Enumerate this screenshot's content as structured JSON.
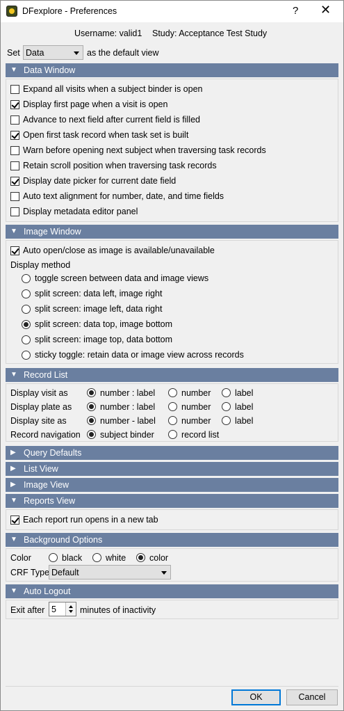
{
  "window": {
    "title": "DFexplore - Preferences",
    "help_glyph": "?",
    "close_glyph": "✕"
  },
  "header": {
    "username": "Username: valid1",
    "study": "Study: Acceptance Test Study"
  },
  "default_view": {
    "prefix": "Set",
    "value": "Data",
    "suffix": "as the default view"
  },
  "sections": {
    "data_window": "Data Window",
    "image_window": "Image Window",
    "record_list": "Record List",
    "query_defaults": "Query Defaults",
    "list_view": "List View",
    "image_view": "Image View",
    "reports_view": "Reports View",
    "background_options": "Background Options",
    "auto_logout": "Auto Logout"
  },
  "data_window": {
    "options": [
      {
        "label": "Expand all visits when a subject binder is open",
        "checked": false
      },
      {
        "label": "Display first page when a visit is open",
        "checked": true
      },
      {
        "label": "Advance to next field after current field is filled",
        "checked": false
      },
      {
        "label": "Open first task record when task set is built",
        "checked": true
      },
      {
        "label": "Warn before opening next subject when traversing task records",
        "checked": false
      },
      {
        "label": "Retain scroll position when traversing task records",
        "checked": false
      },
      {
        "label": "Display date picker for current date field",
        "checked": true
      },
      {
        "label": "Auto text alignment for number, date, and time fields",
        "checked": false
      },
      {
        "label": "Display metadata editor panel",
        "checked": false
      }
    ]
  },
  "image_window": {
    "auto_open": {
      "label": "Auto open/close as image is available/unavailable",
      "checked": true
    },
    "display_method_label": "Display method",
    "methods": [
      {
        "label": "toggle screen between data and image views",
        "selected": false
      },
      {
        "label": "split screen: data left, image right",
        "selected": false
      },
      {
        "label": "split screen: image left, data right",
        "selected": false
      },
      {
        "label": "split screen: data top, image bottom",
        "selected": true
      },
      {
        "label": "split screen: image top, data bottom",
        "selected": false
      },
      {
        "label": "sticky toggle: retain data or image view across records",
        "selected": false
      }
    ]
  },
  "record_list": {
    "rows": [
      {
        "label": "Display visit as",
        "opts": [
          "number : label",
          "number",
          "label"
        ],
        "selected": 0
      },
      {
        "label": "Display plate as",
        "opts": [
          "number : label",
          "number",
          "label"
        ],
        "selected": 0
      },
      {
        "label": "Display site as",
        "opts": [
          "number - label",
          "number",
          "label"
        ],
        "selected": 0
      },
      {
        "label": "Record navigation",
        "opts": [
          "subject binder",
          "record list"
        ],
        "selected": 0
      }
    ]
  },
  "reports_view": {
    "new_tab": {
      "label": "Each report run opens in a new tab",
      "checked": true
    }
  },
  "background_options": {
    "color_label": "Color",
    "colors": [
      {
        "label": "black",
        "selected": false
      },
      {
        "label": "white",
        "selected": false
      },
      {
        "label": "color",
        "selected": true
      }
    ],
    "crf_type_label": "CRF Type",
    "crf_type_value": "Default"
  },
  "auto_logout": {
    "prefix": "Exit after",
    "value": "5",
    "suffix": "minutes of inactivity"
  },
  "buttons": {
    "ok": "OK",
    "cancel": "Cancel"
  },
  "icons": {
    "expanded": "triangle-down-icon",
    "collapsed": "triangle-right-icon"
  },
  "colors": {
    "section_bar": "#6a7fa0",
    "ok_border": "#0078d7"
  }
}
